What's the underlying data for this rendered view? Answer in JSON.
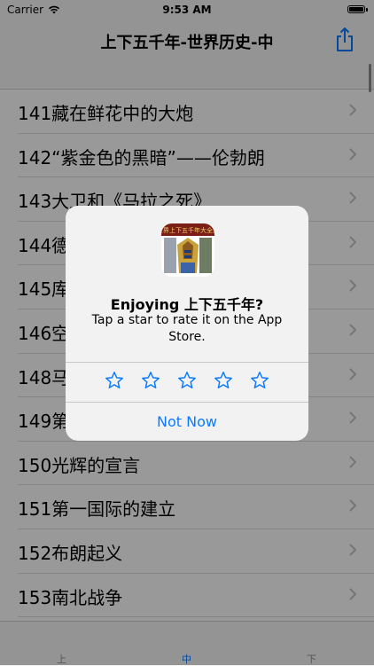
{
  "status_bar": {
    "carrier": "Carrier",
    "time": "9:53 AM"
  },
  "nav": {
    "title": "上下五千年-世界历史-中",
    "share_icon": "share-icon"
  },
  "list": {
    "items": [
      {
        "label": "141藏在鲜花中的大炮"
      },
      {
        "label": "142“紫金色的黑暗”——伦勃朗"
      },
      {
        "label": "143大卫和《马拉之死》"
      },
      {
        "label": "144德"
      },
      {
        "label": "145库"
      },
      {
        "label": "146空"
      },
      {
        "label": "148马"
      },
      {
        "label": "149第"
      },
      {
        "label": "150光辉的宣言"
      },
      {
        "label": "151第一国际的建立"
      },
      {
        "label": "152布朗起义"
      },
      {
        "label": "153南北战争"
      }
    ]
  },
  "tabs": [
    {
      "label": "上",
      "active": false
    },
    {
      "label": "中",
      "active": true
    },
    {
      "label": "下",
      "active": false
    }
  ],
  "alert": {
    "title": "Enjoying 上下五千年?",
    "message": "Tap a star to rate it on the App Store.",
    "stars": 5,
    "dismiss_label": "Not Now",
    "icon_text": "世界上下五千年大全集"
  },
  "colors": {
    "accent": "#0a7aff"
  }
}
